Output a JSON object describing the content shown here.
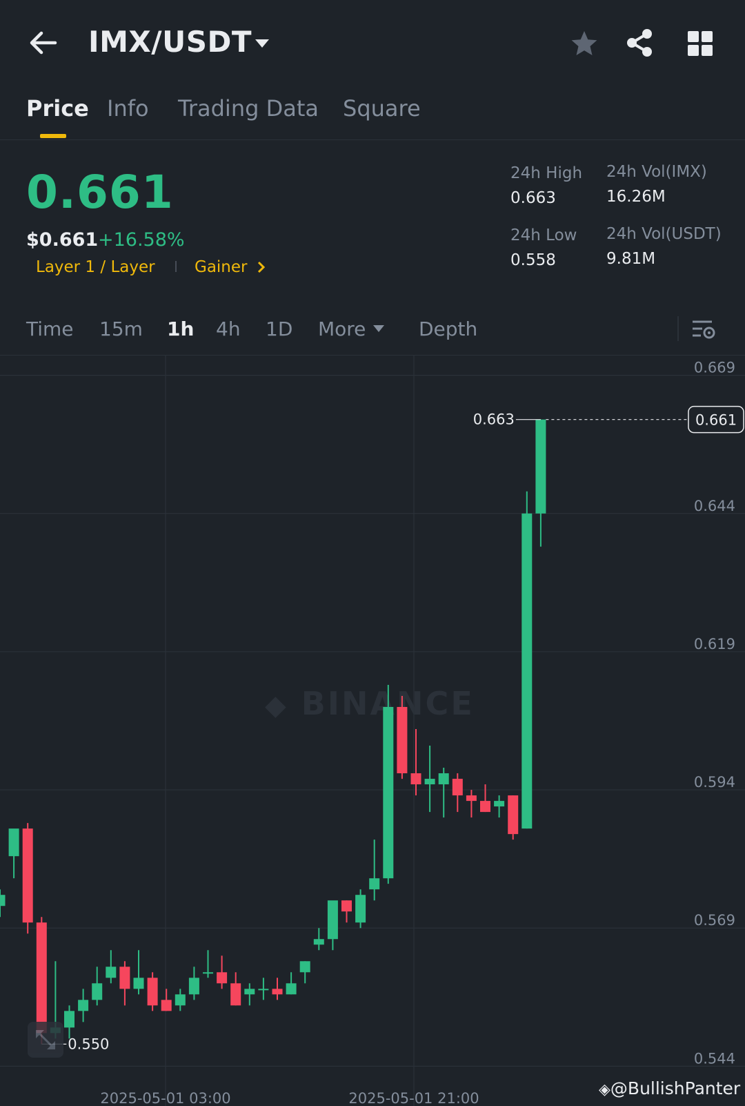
{
  "header": {
    "pair": "IMX/USDT",
    "icons": [
      "back-arrow-icon",
      "caret-down-icon",
      "star-icon",
      "share-icon",
      "grid-icon"
    ]
  },
  "tabs": [
    {
      "label": "Price",
      "active": true
    },
    {
      "label": "Info",
      "active": false
    },
    {
      "label": "Trading Data",
      "active": false
    },
    {
      "label": "Square",
      "active": false
    }
  ],
  "price": {
    "last": "0.661",
    "usd": "$0.661",
    "change": "+16.58%",
    "tag_layer": "Layer 1 / Layer",
    "tag_gainer": "Gainer"
  },
  "stats": {
    "high_label": "24h High",
    "high_value": "0.663",
    "low_label": "24h Low",
    "low_value": "0.558",
    "vol_imx_label": "24h Vol(IMX)",
    "vol_imx_value": "16.26M",
    "vol_usdt_label": "24h Vol(USDT)",
    "vol_usdt_value": "9.81M"
  },
  "intervals": [
    {
      "label": "Time",
      "active": false
    },
    {
      "label": "15m",
      "active": false
    },
    {
      "label": "1h",
      "active": true
    },
    {
      "label": "4h",
      "active": false
    },
    {
      "label": "1D",
      "active": false
    },
    {
      "label": "More",
      "active": false
    },
    {
      "label": "Depth",
      "active": false
    }
  ],
  "colors": {
    "up": "#2ebd85",
    "down": "#f6465d",
    "accent": "#f0b90b",
    "bg": "#1e2329",
    "grid": "#2b3139"
  },
  "watermark": "BINANCE",
  "credit": "@BullishPanter",
  "chart_data": {
    "type": "candlestick",
    "interval": "1h",
    "y_axis_ticks": [
      "0.669",
      "0.644",
      "0.619",
      "0.594",
      "0.569",
      "0.544"
    ],
    "ylim": [
      0.5418,
      0.6717
    ],
    "x_axis_ticks": [
      "2025-05-01 03:00",
      "2025-05-01 21:00"
    ],
    "last_price_label": "0.661",
    "high_marker": "0.663",
    "low_marker": "0.550",
    "candles": [
      {
        "o": 0.573,
        "h": 0.576,
        "l": 0.571,
        "c": 0.575
      },
      {
        "o": 0.582,
        "h": 0.586,
        "l": 0.578,
        "c": 0.587
      },
      {
        "o": 0.587,
        "h": 0.588,
        "l": 0.568,
        "c": 0.57
      },
      {
        "o": 0.57,
        "h": 0.571,
        "l": 0.548,
        "c": 0.55
      },
      {
        "o": 0.55,
        "h": 0.563,
        "l": 0.549,
        "c": 0.551
      },
      {
        "o": 0.551,
        "h": 0.555,
        "l": 0.549,
        "c": 0.554
      },
      {
        "o": 0.554,
        "h": 0.558,
        "l": 0.552,
        "c": 0.556
      },
      {
        "o": 0.556,
        "h": 0.562,
        "l": 0.555,
        "c": 0.559
      },
      {
        "o": 0.56,
        "h": 0.565,
        "l": 0.559,
        "c": 0.562
      },
      {
        "o": 0.562,
        "h": 0.563,
        "l": 0.555,
        "c": 0.558
      },
      {
        "o": 0.558,
        "h": 0.565,
        "l": 0.557,
        "c": 0.56
      },
      {
        "o": 0.56,
        "h": 0.561,
        "l": 0.554,
        "c": 0.555
      },
      {
        "o": 0.556,
        "h": 0.558,
        "l": 0.554,
        "c": 0.554
      },
      {
        "o": 0.555,
        "h": 0.558,
        "l": 0.554,
        "c": 0.557
      },
      {
        "o": 0.557,
        "h": 0.562,
        "l": 0.556,
        "c": 0.56
      },
      {
        "o": 0.561,
        "h": 0.565,
        "l": 0.56,
        "c": 0.561
      },
      {
        "o": 0.561,
        "h": 0.564,
        "l": 0.558,
        "c": 0.559
      },
      {
        "o": 0.559,
        "h": 0.561,
        "l": 0.555,
        "c": 0.555
      },
      {
        "o": 0.557,
        "h": 0.559,
        "l": 0.555,
        "c": 0.558
      },
      {
        "o": 0.558,
        "h": 0.56,
        "l": 0.556,
        "c": 0.558
      },
      {
        "o": 0.558,
        "h": 0.56,
        "l": 0.556,
        "c": 0.557
      },
      {
        "o": 0.557,
        "h": 0.561,
        "l": 0.557,
        "c": 0.559
      },
      {
        "o": 0.561,
        "h": 0.563,
        "l": 0.559,
        "c": 0.563
      },
      {
        "o": 0.566,
        "h": 0.569,
        "l": 0.565,
        "c": 0.567
      },
      {
        "o": 0.567,
        "h": 0.573,
        "l": 0.565,
        "c": 0.574
      },
      {
        "o": 0.574,
        "h": 0.574,
        "l": 0.57,
        "c": 0.572
      },
      {
        "o": 0.57,
        "h": 0.576,
        "l": 0.569,
        "c": 0.575
      },
      {
        "o": 0.576,
        "h": 0.585,
        "l": 0.574,
        "c": 0.578
      },
      {
        "o": 0.578,
        "h": 0.613,
        "l": 0.577,
        "c": 0.609
      },
      {
        "o": 0.609,
        "h": 0.611,
        "l": 0.596,
        "c": 0.597
      },
      {
        "o": 0.597,
        "h": 0.605,
        "l": 0.593,
        "c": 0.595
      },
      {
        "o": 0.595,
        "h": 0.602,
        "l": 0.59,
        "c": 0.596
      },
      {
        "o": 0.595,
        "h": 0.598,
        "l": 0.589,
        "c": 0.597
      },
      {
        "o": 0.596,
        "h": 0.597,
        "l": 0.59,
        "c": 0.593
      },
      {
        "o": 0.593,
        "h": 0.594,
        "l": 0.589,
        "c": 0.592
      },
      {
        "o": 0.592,
        "h": 0.595,
        "l": 0.59,
        "c": 0.59
      },
      {
        "o": 0.591,
        "h": 0.593,
        "l": 0.589,
        "c": 0.592
      },
      {
        "o": 0.593,
        "h": 0.593,
        "l": 0.585,
        "c": 0.586
      },
      {
        "o": 0.587,
        "h": 0.648,
        "l": 0.587,
        "c": 0.644
      },
      {
        "o": 0.644,
        "h": 0.661,
        "l": 0.638,
        "c": 0.661
      }
    ]
  }
}
